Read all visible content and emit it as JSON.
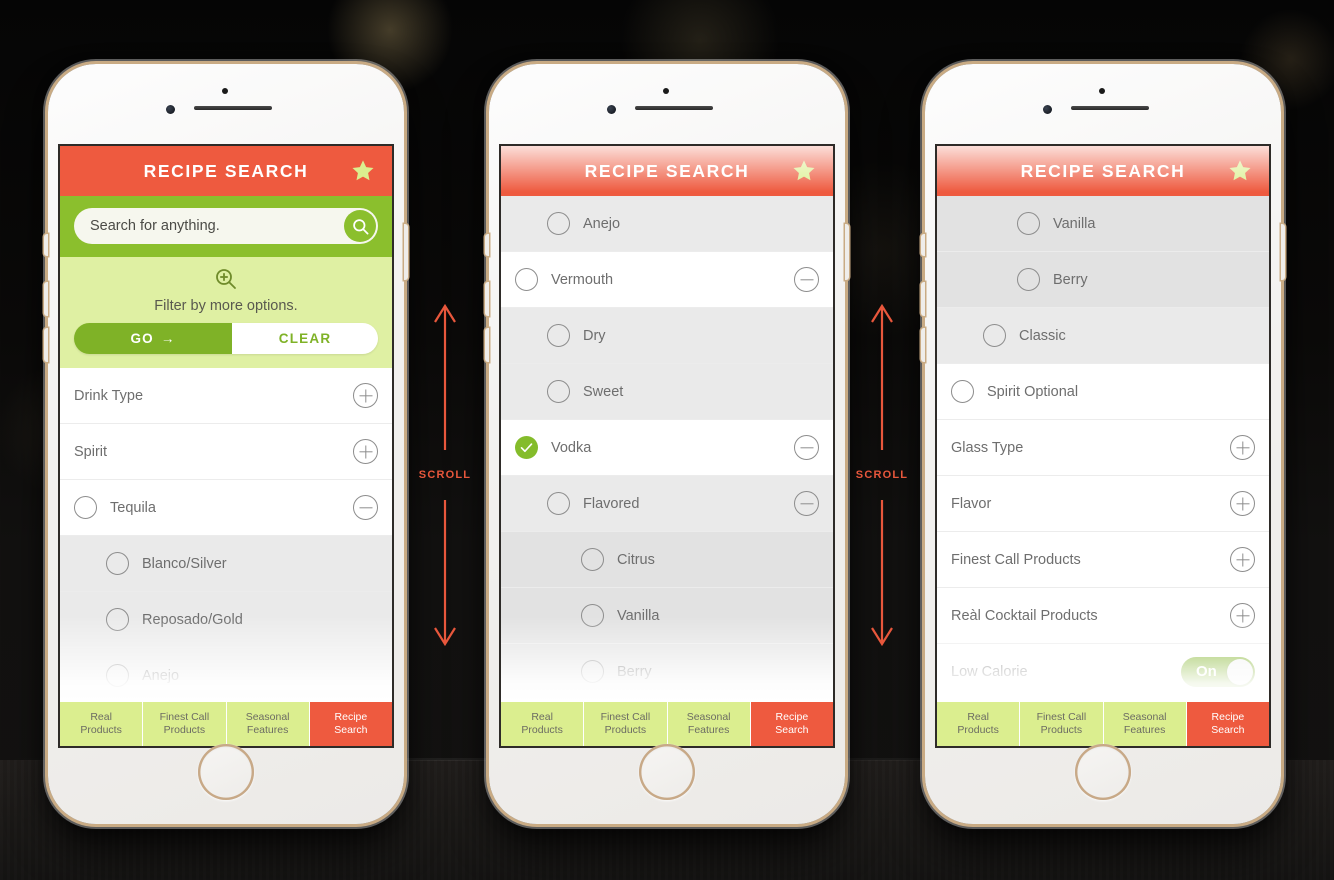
{
  "app": {
    "title": "RECIPE SEARCH",
    "star_icon": "star-icon"
  },
  "search": {
    "placeholder": "Search for anything.",
    "search_icon": "magnifier-icon"
  },
  "filter": {
    "icon": "magnifier-plus-icon",
    "text": "Filter by more options.",
    "go_label": "GO",
    "go_arrow": "→",
    "clear_label": "CLEAR"
  },
  "annotations": {
    "scroll_label": "SCROLL"
  },
  "colors": {
    "header_coral": "#ee5a3f",
    "search_green": "#8bbf2d",
    "filter_green": "#dff0a3",
    "nav_green": "#dbee8f",
    "accent_green": "#7fb227",
    "star_yellow_green": "#dbef8f"
  },
  "bottom_nav": {
    "tabs": [
      {
        "line1": "Real",
        "line2": "Products",
        "active": false
      },
      {
        "line1": "Finest Call",
        "line2": "Products",
        "active": false
      },
      {
        "line1": "Seasonal",
        "line2": "Features",
        "active": false
      },
      {
        "line1": "Recipe",
        "line2": "Search",
        "active": true
      }
    ]
  },
  "phones": [
    {
      "id": "phone-1",
      "shows_search_panel": true,
      "rows": [
        {
          "label": "Drink Type",
          "level": 0,
          "radio": false,
          "control": "plus"
        },
        {
          "label": "Spirit",
          "level": 0,
          "radio": false,
          "control": "plus"
        },
        {
          "label": "Tequila",
          "level": 0,
          "radio": true,
          "checked": false,
          "control": "minus"
        },
        {
          "label": "Blanco/Silver",
          "level": 2,
          "radio": true,
          "checked": false,
          "control": "none"
        },
        {
          "label": "Reposado/Gold",
          "level": 2,
          "radio": true,
          "checked": false,
          "control": "none"
        },
        {
          "label": "Anejo",
          "level": 2,
          "radio": true,
          "checked": false,
          "control": "none"
        }
      ]
    },
    {
      "id": "phone-2",
      "shows_search_panel": false,
      "rows": [
        {
          "label": "Anejo",
          "level": 2,
          "radio": true,
          "checked": false,
          "control": "none"
        },
        {
          "label": "Vermouth",
          "level": 0,
          "radio": true,
          "checked": false,
          "control": "minus"
        },
        {
          "label": "Dry",
          "level": 2,
          "radio": true,
          "checked": false,
          "control": "none"
        },
        {
          "label": "Sweet",
          "level": 2,
          "radio": true,
          "checked": false,
          "control": "none"
        },
        {
          "label": "Vodka",
          "level": 0,
          "radio": true,
          "checked": true,
          "control": "minus"
        },
        {
          "label": "Flavored",
          "level": 2,
          "radio": true,
          "checked": false,
          "control": "minus"
        },
        {
          "label": "Citrus",
          "level": 3,
          "radio": true,
          "checked": false,
          "control": "none"
        },
        {
          "label": "Vanilla",
          "level": 3,
          "radio": true,
          "checked": false,
          "control": "none"
        },
        {
          "label": "Berry",
          "level": 3,
          "radio": true,
          "checked": false,
          "control": "none"
        }
      ]
    },
    {
      "id": "phone-3",
      "shows_search_panel": false,
      "rows": [
        {
          "label": "Vanilla",
          "level": 3,
          "radio": true,
          "checked": false,
          "control": "none"
        },
        {
          "label": "Berry",
          "level": 3,
          "radio": true,
          "checked": false,
          "control": "none"
        },
        {
          "label": "Classic",
          "level": 2,
          "radio": true,
          "checked": false,
          "control": "none"
        },
        {
          "label": "Spirit Optional",
          "level": 0,
          "radio": true,
          "checked": false,
          "control": "none"
        },
        {
          "label": "Glass Type",
          "level": 0,
          "radio": false,
          "control": "plus"
        },
        {
          "label": "Flavor",
          "level": 0,
          "radio": false,
          "control": "plus"
        },
        {
          "label": "Finest Call Products",
          "level": 0,
          "radio": false,
          "control": "plus"
        },
        {
          "label": "Reàl Cocktail Products",
          "level": 0,
          "radio": false,
          "control": "plus"
        },
        {
          "label": "Low Calorie",
          "level": 0,
          "radio": false,
          "control": "toggle",
          "toggle_label": "On",
          "toggle_on": true
        }
      ]
    }
  ]
}
